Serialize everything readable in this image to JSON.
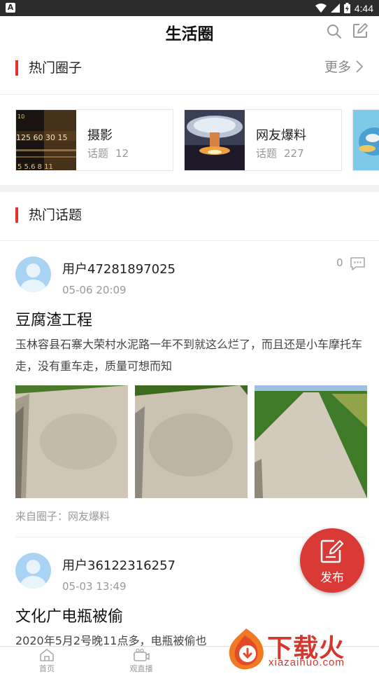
{
  "status_bar": {
    "time": "4:44",
    "left_icon": "A"
  },
  "header": {
    "title": "生活圈"
  },
  "hot_circles": {
    "heading": "热门圈子",
    "more_label": "更多",
    "cards": [
      {
        "name": "摄影",
        "topics_label": "话题",
        "topics_count": "12",
        "image": "camera-dial-image"
      },
      {
        "name": "网友爆料",
        "topics_label": "话题",
        "topics_count": "227",
        "image": "mushroom-cloud-image"
      },
      {
        "name": "",
        "topics_label": "",
        "topics_count": "",
        "image": "globe-image"
      }
    ]
  },
  "hot_topics": {
    "heading": "热门话题"
  },
  "posts": [
    {
      "username": "用户47281897025",
      "time": "05-06 20:09",
      "comment_count": "0",
      "title": "豆腐渣工程",
      "body": "玉林容县石寨大荣村水泥路一年不到就这么烂了，而且还是小车摩托车走，没有重车走，质量可想而知",
      "images": [
        "road-photo-1",
        "road-photo-2",
        "road-photo-3"
      ],
      "source": "来自圈子：网友爆料"
    },
    {
      "username": "用户36122316257",
      "time": "05-03 13:49",
      "title": "文化广电瓶被偷",
      "body": "2020年5月2号晚11点多，电瓶被偷也"
    }
  ],
  "fab": {
    "label": "发布"
  },
  "bottom_nav": [
    {
      "label": "首页"
    },
    {
      "label": "观直播"
    },
    {
      "label": ""
    },
    {
      "label": ""
    },
    {
      "label": ""
    }
  ],
  "watermark": {
    "text": "下载火",
    "url": "xiazaihuo.com"
  },
  "colors": {
    "accent": "#e2332f",
    "fab": "#d93a36",
    "avatar": "#a9d3f3"
  }
}
